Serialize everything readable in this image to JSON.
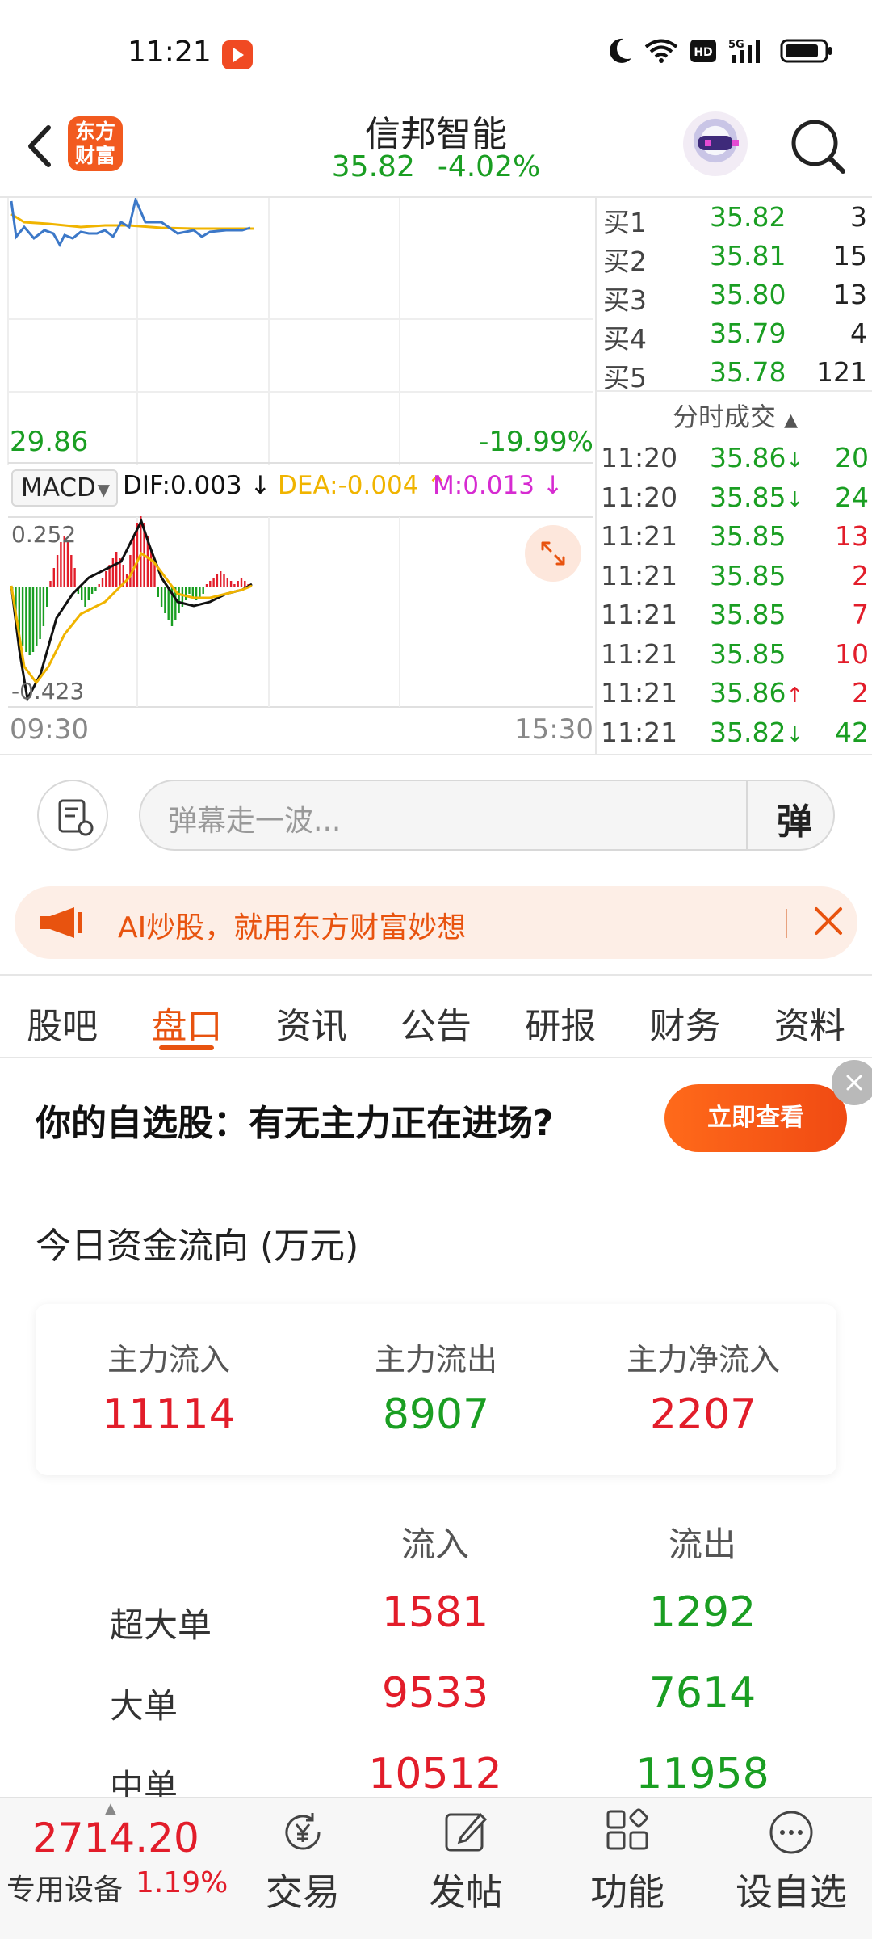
{
  "status_bar": {
    "time": "11:21",
    "icons": [
      "moon-icon",
      "wifi-icon",
      "hd-icon",
      "5g-signal-icon",
      "battery-icon"
    ]
  },
  "header": {
    "logo_line1": "东方",
    "logo_line2": "财富",
    "stock_name": "信邦智能",
    "price": "35.82",
    "change_pct": "-4.02%"
  },
  "chart": {
    "low_price": "29.86",
    "low_pct": "-19.99%",
    "indicator": "MACD",
    "dif": "DIF:0.003",
    "dea": "DEA:-0.004",
    "m": "M:0.013",
    "macd_max": "0.252",
    "macd_min": "-0.423",
    "time_start": "09:30",
    "time_end": "15:30",
    "colors": {
      "up": "#e21d2a",
      "down": "#1a9e22",
      "price_line": "#3c78c8",
      "avg_line": "#f0b400"
    }
  },
  "order_book": {
    "bids": [
      {
        "label": "买1",
        "price": "35.82",
        "vol": "3"
      },
      {
        "label": "买2",
        "price": "35.81",
        "vol": "15"
      },
      {
        "label": "买3",
        "price": "35.80",
        "vol": "13"
      },
      {
        "label": "买4",
        "price": "35.79",
        "vol": "4"
      },
      {
        "label": "买5",
        "price": "35.78",
        "vol": "121"
      }
    ],
    "ticks_title": "分时成交",
    "ticks": [
      {
        "time": "11:20",
        "price": "35.86",
        "dir": "down",
        "vol": "20"
      },
      {
        "time": "11:20",
        "price": "35.85",
        "dir": "down",
        "vol": "24"
      },
      {
        "time": "11:21",
        "price": "35.85",
        "dir": "",
        "vol": "13"
      },
      {
        "time": "11:21",
        "price": "35.85",
        "dir": "",
        "vol": "2"
      },
      {
        "time": "11:21",
        "price": "35.85",
        "dir": "",
        "vol": "7"
      },
      {
        "time": "11:21",
        "price": "35.85",
        "dir": "",
        "vol": "10"
      },
      {
        "time": "11:21",
        "price": "35.86",
        "dir": "up",
        "vol": "2"
      },
      {
        "time": "11:21",
        "price": "35.82",
        "dir": "down",
        "vol": "42"
      }
    ]
  },
  "danmu": {
    "placeholder": "弹幕走一波...",
    "button": "弹"
  },
  "ai_banner": {
    "text": "AI炒股，就用东方财富妙想"
  },
  "tabs": [
    "股吧",
    "盘口",
    "资讯",
    "公告",
    "研报",
    "财务",
    "资料"
  ],
  "active_tab": 1,
  "promo": {
    "text": "你的自选股：有无主力正在进场?",
    "button": "立即查看"
  },
  "fund_flow": {
    "title": "今日资金流向 (万元)",
    "summary": [
      {
        "label": "主力流入",
        "value": "11114",
        "color": "#e21d2a"
      },
      {
        "label": "主力流出",
        "value": "8907",
        "color": "#1a9e22"
      },
      {
        "label": "主力净流入",
        "value": "2207",
        "color": "#e21d2a"
      }
    ],
    "col_in": "流入",
    "col_out": "流出",
    "rows": [
      {
        "label": "超大单",
        "in": "1581",
        "out": "1292"
      },
      {
        "label": "大单",
        "in": "9533",
        "out": "7614"
      },
      {
        "label": "中单",
        "in": "10512",
        "out": "11958"
      }
    ]
  },
  "bottom_bar": {
    "index_value": "2714.20",
    "index_name": "专用设备",
    "index_pct": "1.19%",
    "nav": [
      {
        "label": "交易",
        "icon": "yen-trade-icon"
      },
      {
        "label": "发帖",
        "icon": "edit-post-icon"
      },
      {
        "label": "功能",
        "icon": "apps-grid-icon"
      },
      {
        "label": "设自选",
        "icon": "more-dots-icon"
      }
    ]
  }
}
